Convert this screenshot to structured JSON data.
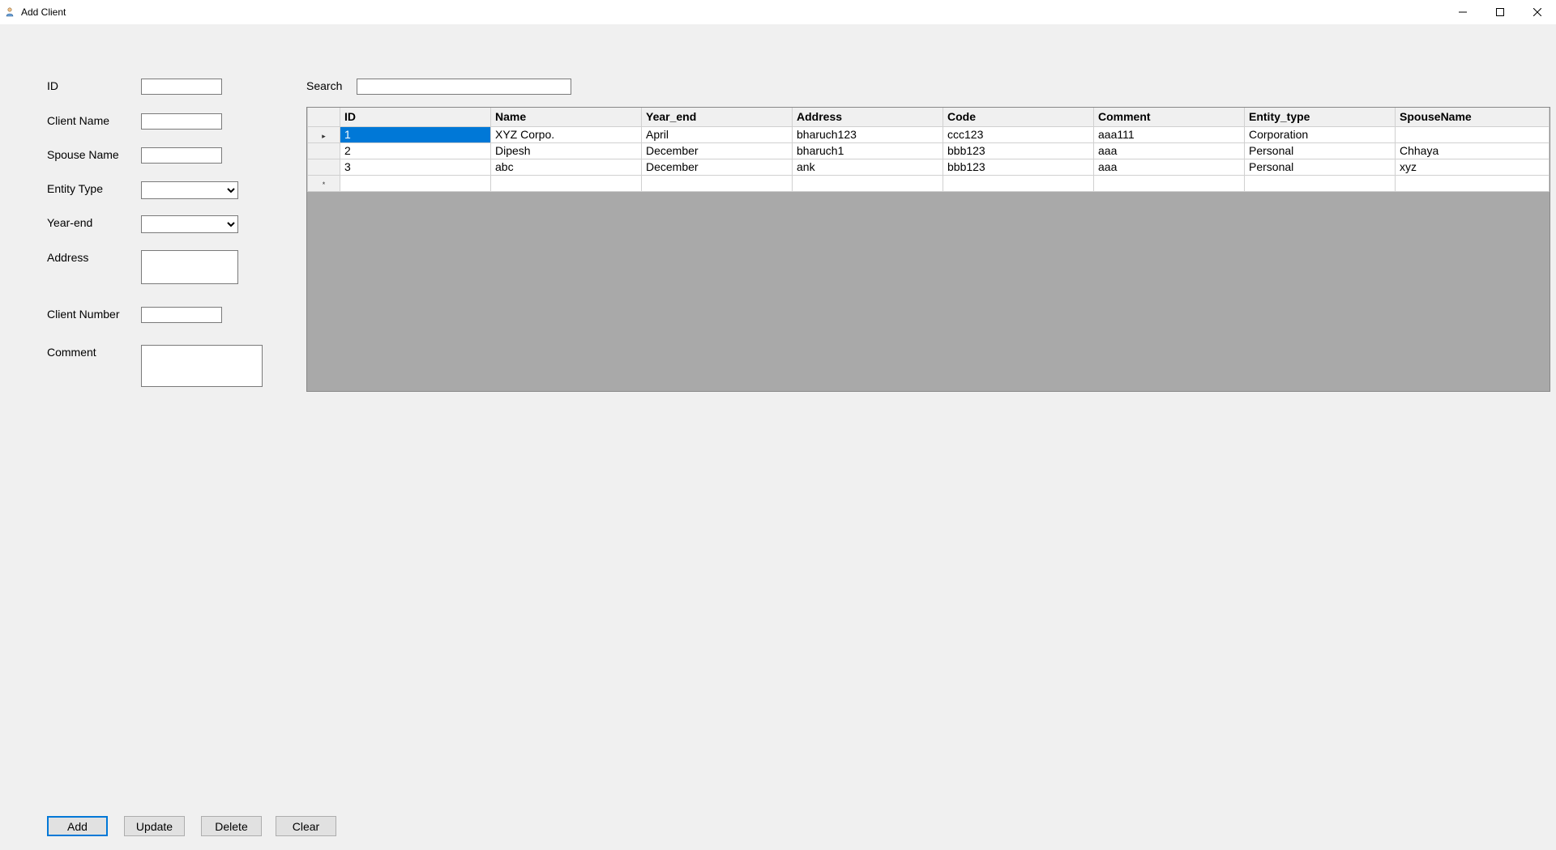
{
  "titlebar": {
    "title": "Add Client"
  },
  "form": {
    "id_label": "ID",
    "client_name_label": "Client Name",
    "spouse_name_label": "Spouse Name",
    "entity_type_label": "Entity Type",
    "year_end_label": "Year-end",
    "address_label": "Address",
    "client_number_label": "Client Number",
    "comment_label": "Comment",
    "id_value": "",
    "client_name_value": "",
    "spouse_name_value": "",
    "entity_type_value": "",
    "year_end_value": "",
    "address_value": "",
    "client_number_value": "",
    "comment_value": ""
  },
  "search": {
    "label": "Search",
    "value": ""
  },
  "grid": {
    "headers": {
      "id": "ID",
      "name": "Name",
      "year_end": "Year_end",
      "address": "Address",
      "code": "Code",
      "comment": "Comment",
      "entity_type": "Entity_type",
      "spouse_name": "SpouseName"
    },
    "rows": [
      {
        "marker": "▸",
        "id": "1",
        "name": "XYZ Corpo.",
        "year_end": "April",
        "address": "bharuch123",
        "code": "ccc123",
        "comment": "aaa111",
        "entity_type": "Corporation",
        "spouse_name": ""
      },
      {
        "marker": "",
        "id": "2",
        "name": "Dipesh",
        "year_end": "December",
        "address": "bharuch1",
        "code": "bbb123",
        "comment": "aaa",
        "entity_type": "Personal",
        "spouse_name": "Chhaya"
      },
      {
        "marker": "",
        "id": "3",
        "name": "abc",
        "year_end": "December",
        "address": "ank",
        "code": "bbb123",
        "comment": "aaa",
        "entity_type": "Personal",
        "spouse_name": "xyz"
      }
    ],
    "new_row_marker": "*"
  },
  "buttons": {
    "add": "Add",
    "update": "Update",
    "delete": "Delete",
    "clear": "Clear"
  }
}
